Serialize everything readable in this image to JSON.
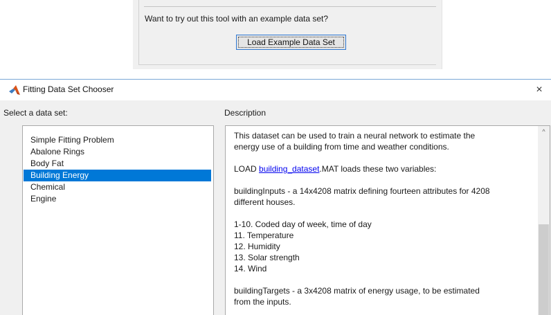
{
  "top_panel": {
    "prompt": "Want to try out this tool with an example data set?",
    "load_button_label": "Load Example Data Set"
  },
  "dialog": {
    "title": "Fitting Data Set Chooser",
    "close_icon": "×",
    "select_label": "Select a data set:",
    "description_label": "Description",
    "datasets": [
      {
        "label": "Simple Fitting Problem",
        "selected": false
      },
      {
        "label": "Abalone Rings",
        "selected": false
      },
      {
        "label": "Body Fat",
        "selected": false
      },
      {
        "label": "Building Energy",
        "selected": true
      },
      {
        "label": "Chemical",
        "selected": false
      },
      {
        "label": "Engine",
        "selected": false
      }
    ],
    "description": {
      "para1": "This dataset can be used to train a neural network to estimate the\nenergy use of a building from time and weather conditions.",
      "load_prefix": "LOAD ",
      "load_link": "building_dataset",
      "load_suffix": ".MAT loads these two variables:",
      "para3": "buildingInputs - a 14x4208 matrix defining fourteen attributes for 4208\ndifferent houses.",
      "para4": "1-10. Coded day of week, time of day\n11. Temperature\n12. Humidity\n13. Solar strength\n14. Wind",
      "para5": "buildingTargets - a 3x4208 matrix of energy usage, to be estimated\nfrom the inputs."
    },
    "scroll_up_icon": "^"
  },
  "colors": {
    "selection": "#0078d7",
    "link": "#0000ee",
    "button_focus": "#2f78d2",
    "matlab_icon": "#d95319"
  }
}
